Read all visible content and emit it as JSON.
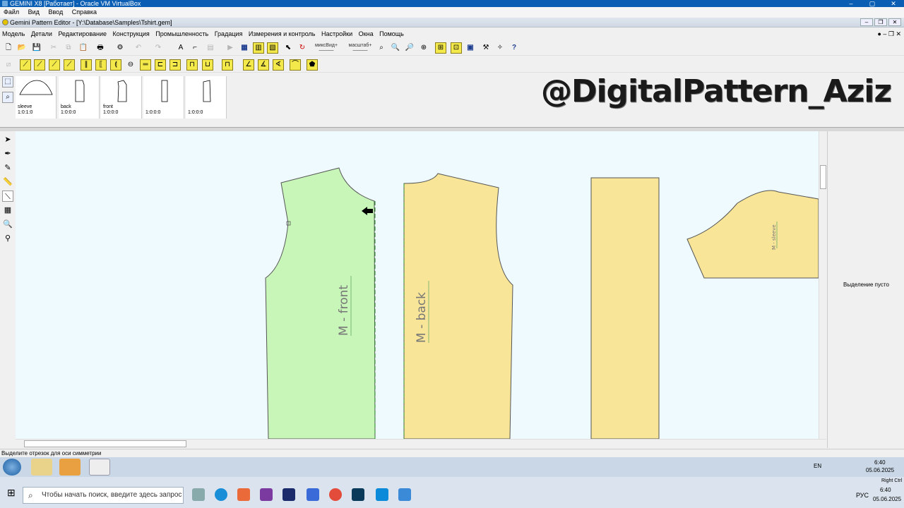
{
  "vbox": {
    "title": "GEMINI X8 [Работает] - Oracle VM VirtualBox",
    "menu": [
      "Файл",
      "Вид",
      "Ввод",
      "Справка"
    ]
  },
  "app": {
    "title": "Gemini Pattern Editor - [Y:\\Database\\Samples\\Tshirt.gem]",
    "menu": [
      "Модель",
      "Детали",
      "Редактирование",
      "Конструкция",
      "Промышленность",
      "Градация",
      "Измерения и контроль",
      "Настройки",
      "Окна",
      "Помощь"
    ]
  },
  "toolbar": {
    "mix_view_label": "миксВид",
    "scale_label": "масштаб"
  },
  "pieces": [
    {
      "name": "sleeve",
      "ratio": "1:0:1:0"
    },
    {
      "name": "back",
      "ratio": "1:0:0:0"
    },
    {
      "name": "front",
      "ratio": "1:0:0:0"
    },
    {
      "name": "",
      "ratio": "1:0:0:0"
    },
    {
      "name": "",
      "ratio": "1:0:0:0"
    }
  ],
  "watermark": "@DigitalPattern_Aziz",
  "canvas": {
    "front_label": "M - front",
    "back_label": "M - back",
    "sleeve_label": "M - sleeve",
    "colors": {
      "front": "#c8f5b8",
      "back": "#f8e597",
      "background": "#effaff"
    }
  },
  "props_panel": {
    "empty_selection": "Выделение пусто"
  },
  "status": {
    "hint": "Выделите отрезок для оси симметрии"
  },
  "vm_taskbar": {
    "lang": "EN",
    "time": "6:40",
    "date": "05.06.2025"
  },
  "host_taskbar": {
    "search_placeholder": "Чтобы начать поиск, введите здесь запрос",
    "lang": "РУС",
    "time": "6:40",
    "date": "05.06.2025",
    "right_ctrl": "Right Ctrl"
  }
}
